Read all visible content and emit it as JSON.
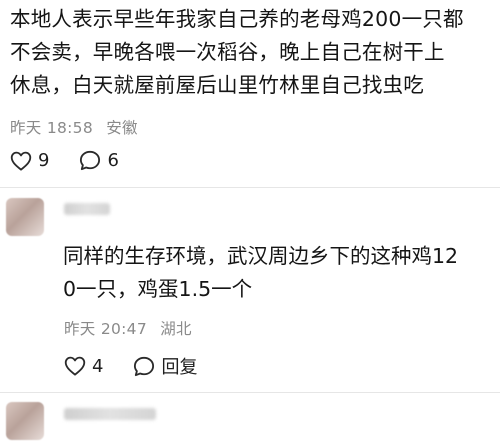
{
  "post": {
    "lines": [
      "本地人表示早些年我家自己养的老母鸡200一只都",
      "不会卖，早晚各喂一次稻谷，晚上自己在树干上",
      "休息，白天就屋前屋后山里竹林里自己找虫吃"
    ],
    "time": "昨天 18:58",
    "location": "安徽",
    "like_count": "9",
    "comment_count": "6"
  },
  "comment": {
    "lines": [
      "同样的生存环境，武汉周边乡下的这种鸡12",
      "0一只，鸡蛋1.5一个"
    ],
    "time": "昨天 20:47",
    "location": "湖北",
    "like_count": "4",
    "reply_label": "回复"
  },
  "icons": {
    "like": "heart-outline-icon",
    "comment": "speech-bubble-icon"
  },
  "colors": {
    "text": "#151515",
    "meta": "#8a8a8a",
    "divider": "#e6e6e6"
  }
}
